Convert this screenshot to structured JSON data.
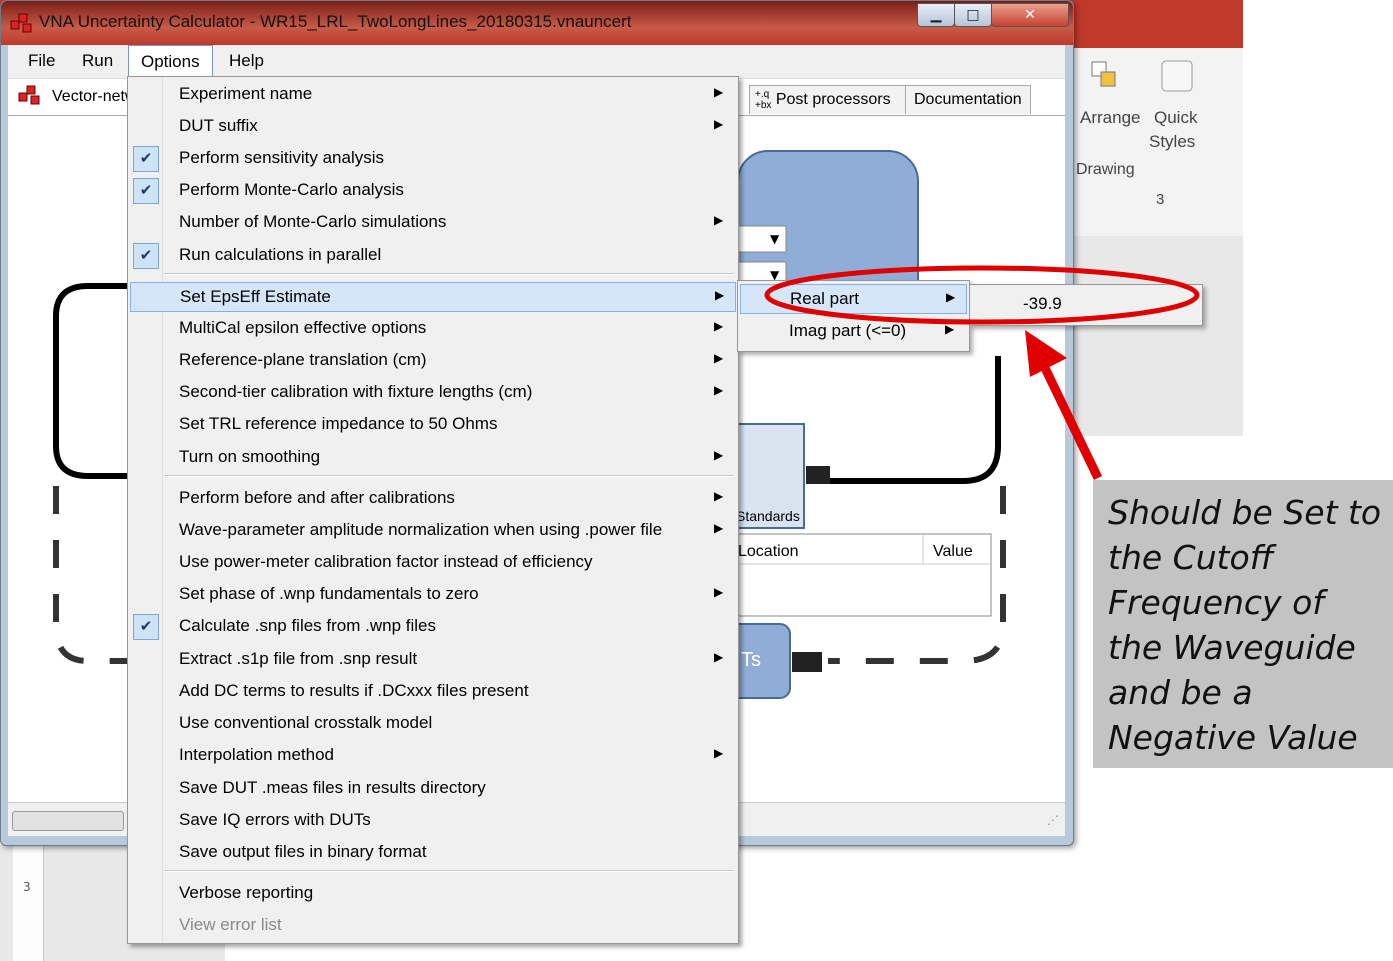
{
  "window": {
    "title": "VNA Uncertainty Calculator - WR15_LRL_TwoLongLines_20180315.vnauncert",
    "min_label": "▁",
    "max_label": "□",
    "close_label": "✕"
  },
  "menubar": {
    "items": [
      {
        "label": "File"
      },
      {
        "label": "Run"
      },
      {
        "label": "Options"
      },
      {
        "label": "Help"
      }
    ]
  },
  "tree": {
    "root_label": "Vector-netw"
  },
  "tabs": [
    {
      "label": "Post processors"
    },
    {
      "label": "Documentation"
    }
  ],
  "canvas": {
    "standards_label": "Standards",
    "location_header": "Location",
    "value_header": "Value",
    "duts_label": "Ts"
  },
  "options_menu": {
    "items": [
      {
        "label": "Experiment name",
        "checked": false,
        "submenu": true
      },
      {
        "label": "DUT suffix",
        "checked": false,
        "submenu": true
      },
      {
        "label": "Perform sensitivity analysis",
        "checked": true,
        "submenu": false
      },
      {
        "label": "Perform Monte-Carlo analysis",
        "checked": true,
        "submenu": false
      },
      {
        "label": "Number of Monte-Carlo simulations",
        "checked": false,
        "submenu": true
      },
      {
        "label": "Run calculations in parallel",
        "checked": true,
        "submenu": false
      },
      {
        "label": "Set EpsEff Estimate",
        "checked": false,
        "submenu": true,
        "highlighted": true
      },
      {
        "label": "MultiCal epsilon effective options",
        "checked": false,
        "submenu": true
      },
      {
        "label": "Reference-plane translation (cm)",
        "checked": false,
        "submenu": true
      },
      {
        "label": "Second-tier calibration with fixture lengths (cm)",
        "checked": false,
        "submenu": true
      },
      {
        "label": "Set TRL reference impedance to 50 Ohms",
        "checked": false,
        "submenu": false
      },
      {
        "label": "Turn on smoothing",
        "checked": false,
        "submenu": true
      },
      {
        "label": "Perform before and after calibrations",
        "checked": false,
        "submenu": true
      },
      {
        "label": "Wave-parameter amplitude normalization when using .power file",
        "checked": false,
        "submenu": true
      },
      {
        "label": "Use power-meter calibration factor instead of efficiency",
        "checked": false,
        "submenu": false
      },
      {
        "label": "Set phase of .wnp fundamentals to zero",
        "checked": false,
        "submenu": true
      },
      {
        "label": "Calculate .snp files from .wnp files",
        "checked": true,
        "submenu": false
      },
      {
        "label": "Extract .s1p file from .snp result",
        "checked": false,
        "submenu": true
      },
      {
        "label": "Add DC terms to results if .DCxxx files present",
        "checked": false,
        "submenu": false
      },
      {
        "label": "Use conventional crosstalk model",
        "checked": false,
        "submenu": false
      },
      {
        "label": "Interpolation method",
        "checked": false,
        "submenu": true
      },
      {
        "label": "Save DUT .meas files in results directory",
        "checked": false,
        "submenu": false
      },
      {
        "label": "Save IQ errors with DUTs",
        "checked": false,
        "submenu": false
      },
      {
        "label": "Save output files in binary format",
        "checked": false,
        "submenu": false
      },
      {
        "label": "Verbose reporting",
        "checked": false,
        "submenu": false
      },
      {
        "label": "View error list",
        "checked": false,
        "submenu": false,
        "disabled": true
      }
    ]
  },
  "epseff_submenu": {
    "items": [
      {
        "label": "Real part",
        "highlighted": true
      },
      {
        "label": "Imag part (<=0)"
      }
    ]
  },
  "real_part_value": "-39.9",
  "ribbon": {
    "arrange_label": "Arrange",
    "quick_label": "Quick",
    "styles_label": "Styles",
    "group_label": "Drawing",
    "ruler_mark": "3"
  },
  "callout": {
    "text": "Should be Set to the Cutoff Frequency of the Waveguide and be a Negative Value"
  },
  "colors": {
    "annotation_red": "#e00000",
    "menu_highlight": "#d5e6f8",
    "block_blue": "#8fadd6"
  },
  "icons": {
    "checkmark": "check-icon",
    "submenu": "submenu-arrow-icon",
    "app": "app-icon"
  }
}
